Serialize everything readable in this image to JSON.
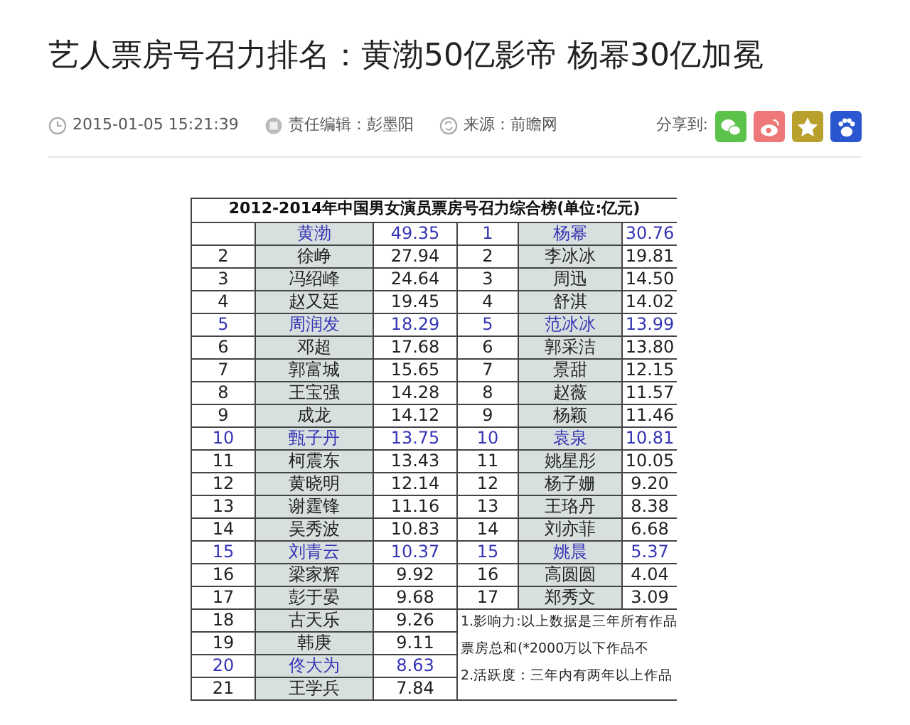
{
  "headline": "艺人票房号召力排名：黄渤50亿影帝 杨幂30亿加冕",
  "meta": [
    {
      "kind": "time",
      "text": "2015-01-05 15:21:39"
    },
    {
      "kind": "editor",
      "text": "责任编辑：彭墨阳"
    },
    {
      "kind": "source",
      "text": "来源：前瞻网"
    }
  ],
  "share": {
    "label": "分享到:",
    "buttons": [
      {
        "kind": "wechat"
      },
      {
        "kind": "weibo"
      },
      {
        "kind": "qzone"
      },
      {
        "kind": "baidu"
      }
    ]
  },
  "table": {
    "title": "2012-2014年中国男女演员票房号召力综合榜(单位:亿元)",
    "rows": [
      {
        "male": {
          "name": "黄渤",
          "value": "49.35",
          "highlighted": true
        },
        "female": {
          "rank": "1",
          "name": "杨幂",
          "value": "30.76",
          "highlighted": true
        }
      },
      {
        "male": {
          "rank": "2",
          "name": "徐峥",
          "value": "27.94",
          "highlighted": false
        },
        "female": {
          "rank": "2",
          "name": "李冰冰",
          "value": "19.81",
          "highlighted": false
        }
      },
      {
        "male": {
          "rank": "3",
          "name": "冯绍峰",
          "value": "24.64",
          "highlighted": false
        },
        "female": {
          "rank": "3",
          "name": "周迅",
          "value": "14.50",
          "highlighted": false
        }
      },
      {
        "male": {
          "rank": "4",
          "name": "赵又廷",
          "value": "19.45",
          "highlighted": false
        },
        "female": {
          "rank": "4",
          "name": "舒淇",
          "value": "14.02",
          "highlighted": false
        }
      },
      {
        "male": {
          "rank": "5",
          "name": "周润发",
          "value": "18.29",
          "highlighted": true
        },
        "female": {
          "rank": "5",
          "name": "范冰冰",
          "value": "13.99",
          "highlighted": true
        }
      },
      {
        "male": {
          "rank": "6",
          "name": "邓超",
          "value": "17.68",
          "highlighted": false
        },
        "female": {
          "rank": "6",
          "name": "郭采洁",
          "value": "13.80",
          "highlighted": false
        }
      },
      {
        "male": {
          "rank": "7",
          "name": "郭富城",
          "value": "15.65",
          "highlighted": false
        },
        "female": {
          "rank": "7",
          "name": "景甜",
          "value": "12.15",
          "highlighted": false
        }
      },
      {
        "male": {
          "rank": "8",
          "name": "王宝强",
          "value": "14.28",
          "highlighted": false
        },
        "female": {
          "rank": "8",
          "name": "赵薇",
          "value": "11.57",
          "highlighted": false
        }
      },
      {
        "male": {
          "rank": "9",
          "name": "成龙",
          "value": "14.12",
          "highlighted": false
        },
        "female": {
          "rank": "9",
          "name": "杨颖",
          "value": "11.46",
          "highlighted": false
        }
      },
      {
        "male": {
          "rank": "10",
          "name": "甄子丹",
          "value": "13.75",
          "highlighted": true
        },
        "female": {
          "rank": "10",
          "name": "袁泉",
          "value": "10.81",
          "highlighted": true
        }
      },
      {
        "male": {
          "rank": "11",
          "name": "柯震东",
          "value": "13.43",
          "highlighted": false
        },
        "female": {
          "rank": "11",
          "name": "姚星彤",
          "value": "10.05",
          "highlighted": false
        }
      },
      {
        "male": {
          "rank": "12",
          "name": "黄晓明",
          "value": "12.14",
          "highlighted": false
        },
        "female": {
          "rank": "12",
          "name": "杨子姗",
          "value": "9.20",
          "highlighted": false
        }
      },
      {
        "male": {
          "rank": "13",
          "name": "谢霆锋",
          "value": "11.16",
          "highlighted": false
        },
        "female": {
          "rank": "13",
          "name": "王珞丹",
          "value": "8.38",
          "highlighted": false
        }
      },
      {
        "male": {
          "rank": "14",
          "name": "吴秀波",
          "value": "10.83",
          "highlighted": false
        },
        "female": {
          "rank": "14",
          "name": "刘亦菲",
          "value": "6.68",
          "highlighted": false
        }
      },
      {
        "male": {
          "rank": "15",
          "name": "刘青云",
          "value": "10.37",
          "highlighted": true
        },
        "female": {
          "rank": "15",
          "name": "姚晨",
          "value": "5.37",
          "highlighted": true
        }
      },
      {
        "male": {
          "rank": "16",
          "name": "梁家辉",
          "value": "9.92",
          "highlighted": false
        },
        "female": {
          "rank": "16",
          "name": "高圆圆",
          "value": "4.04",
          "highlighted": false
        }
      },
      {
        "male": {
          "rank": "17",
          "name": "彭于晏",
          "value": "9.68",
          "highlighted": false
        },
        "female": {
          "rank": "17",
          "name": "郑秀文",
          "value": "3.09",
          "highlighted": false
        }
      },
      {
        "male": {
          "rank": "18",
          "name": "古天乐",
          "value": "9.26",
          "highlighted": false
        }
      },
      {
        "male": {
          "rank": "19",
          "name": "韩庚",
          "value": "9.11",
          "highlighted": false
        }
      },
      {
        "male": {
          "rank": "20",
          "name": "佟大为",
          "value": "8.63",
          "highlighted": true
        }
      },
      {
        "male": {
          "rank": "21",
          "name": "王学兵",
          "value": "7.84",
          "highlighted": false
        }
      }
    ],
    "notes": [
      "1.影响力:以上数据是三年所有作品",
      "票房总和(*2000万以下作品不",
      "2.活跃度：三年内有两年以上作品"
    ]
  }
}
